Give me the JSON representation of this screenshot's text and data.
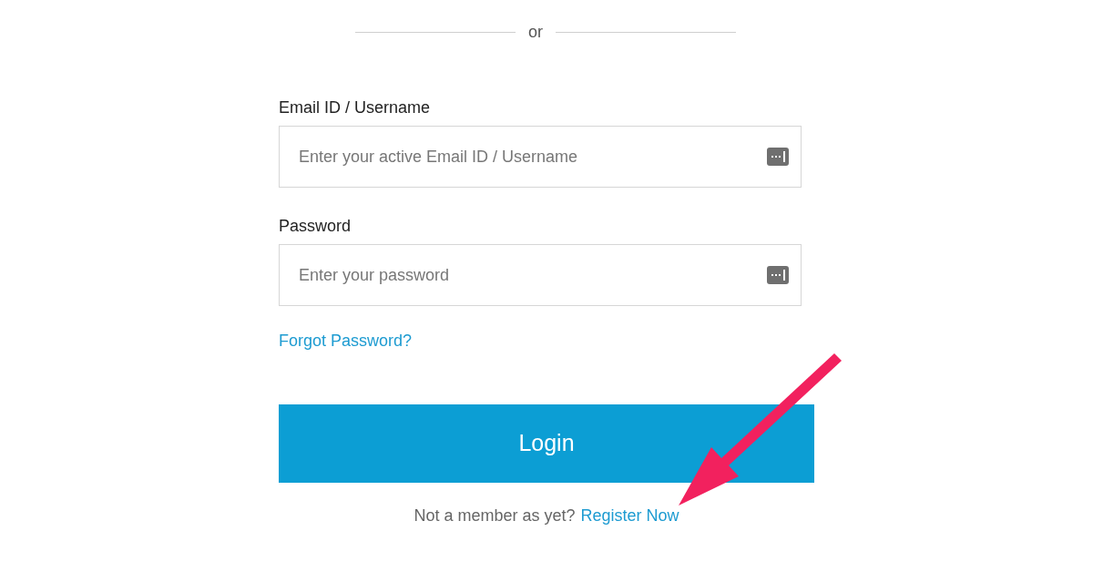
{
  "divider": {
    "text": "or"
  },
  "fields": [
    {
      "label": "Email ID / Username",
      "placeholder": "Enter your active Email ID / Username"
    },
    {
      "label": "Password",
      "placeholder": "Enter your password"
    }
  ],
  "forgot_link": "Forgot Password?",
  "login_button": "Login",
  "footer": {
    "prompt": "Not a member as yet?",
    "link": "Register Now"
  }
}
